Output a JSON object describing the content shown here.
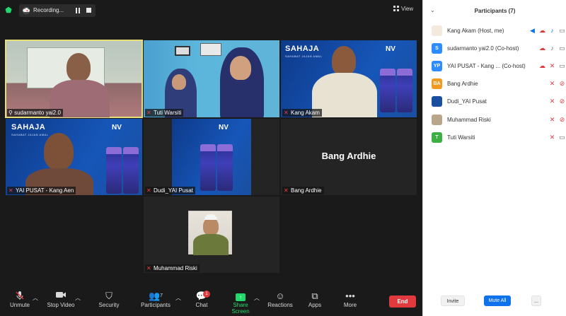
{
  "topbar": {
    "recording_label": "Recording...",
    "view_label": "View"
  },
  "tiles": [
    {
      "name": "sudarmanto yai2.0",
      "muted": false,
      "pinned": true
    },
    {
      "name": "Tuti Warsiti",
      "muted": true
    },
    {
      "name": "Kang Akam",
      "muted": true
    },
    {
      "name": "YAI PUSAT - Kang Aen",
      "muted": true
    },
    {
      "name": "Dudi_YAI Pusat",
      "muted": true
    },
    {
      "name": "Bang Ardhie",
      "muted": true,
      "display_name": "Bang Ardhie"
    },
    {
      "name": "Muhammad Riski",
      "muted": true
    }
  ],
  "brand": {
    "title": "SAHAJA",
    "subtitle": "SAHABAT JAJAN AMAL",
    "logo": "NV"
  },
  "toolbar": {
    "unmute": "Unmute",
    "stop_video": "Stop Video",
    "security": "Security",
    "participants": "Participants",
    "participants_count": "7",
    "chat": "Chat",
    "chat_badge": "1",
    "share_screen": "Share Screen",
    "reactions": "Reactions",
    "apps": "Apps",
    "more": "More",
    "end": "End"
  },
  "panel": {
    "title": "Participants (7)",
    "participants": [
      {
        "name": "Kang Akam (Host, me)",
        "avatar": "",
        "avatar_color": "#f3e9dc"
      },
      {
        "name": "sudarmanto yai2.0 (Co-host)",
        "avatar": "S",
        "avatar_color": "#2d8cff"
      },
      {
        "name": "YAI PUSAT - Kang ...  (Co-host)",
        "avatar": "YP",
        "avatar_color": "#2d8cff"
      },
      {
        "name": "Bang Ardhie",
        "avatar": "BA",
        "avatar_color": "#f29a1f"
      },
      {
        "name": "Dudi_YAI Pusat",
        "avatar": "",
        "avatar_color": "#1a4fa0"
      },
      {
        "name": "Muhammad Riski",
        "avatar": "",
        "avatar_color": "#b8a58a"
      },
      {
        "name": "Tuti Warsiti",
        "avatar": "T",
        "avatar_color": "#3cb043"
      }
    ],
    "invite": "Invite",
    "mute_all": "Mute All",
    "more": "..."
  }
}
